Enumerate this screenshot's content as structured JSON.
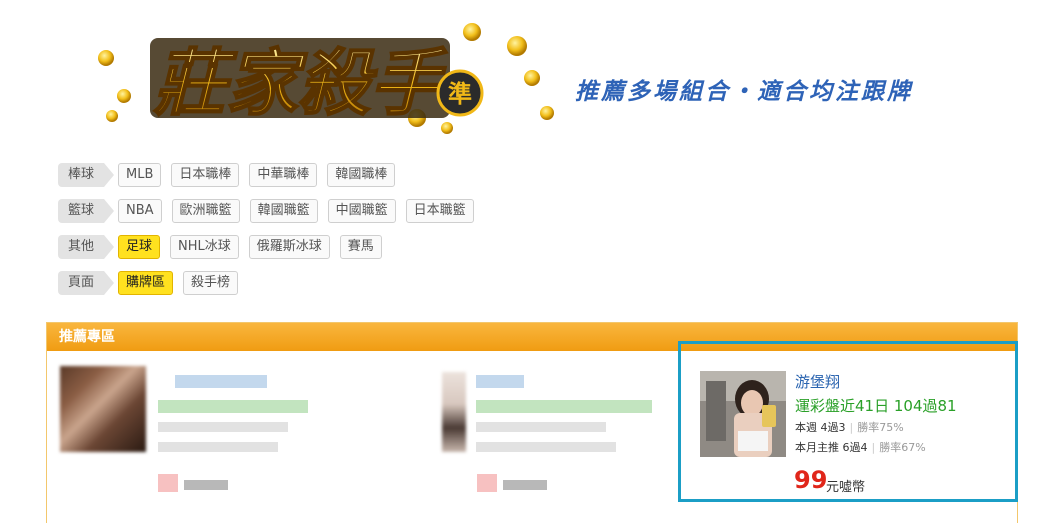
{
  "header": {
    "logo_text": "莊家殺手",
    "logo_badge": "準",
    "slogan": "推薦多場組合・適合均注跟牌"
  },
  "filters": [
    {
      "category": "棒球",
      "items": [
        {
          "label": "MLB",
          "active": false
        },
        {
          "label": "日本職棒",
          "active": false
        },
        {
          "label": "中華職棒",
          "active": false
        },
        {
          "label": "韓國職棒",
          "active": false
        }
      ]
    },
    {
      "category": "籃球",
      "items": [
        {
          "label": "NBA",
          "active": false
        },
        {
          "label": "歐洲職籃",
          "active": false
        },
        {
          "label": "韓國職籃",
          "active": false
        },
        {
          "label": "中國職籃",
          "active": false
        },
        {
          "label": "日本職籃",
          "active": false
        }
      ]
    },
    {
      "category": "其他",
      "items": [
        {
          "label": "足球",
          "active": true
        },
        {
          "label": "NHL冰球",
          "active": false
        },
        {
          "label": "俄羅斯冰球",
          "active": false
        },
        {
          "label": "賽馬",
          "active": false
        }
      ]
    },
    {
      "category": "頁面",
      "items": [
        {
          "label": "購牌區",
          "active": true
        },
        {
          "label": "殺手榜",
          "active": false
        }
      ]
    }
  ],
  "panel": {
    "title": "推薦專區",
    "featured": {
      "name": "游堡翔",
      "record": "運彩盤近41日 104過81",
      "week_record": "本週 4過3",
      "week_rate": "勝率75%",
      "month_record": "本月主推 6過4",
      "month_rate": "勝率67%",
      "price": "99",
      "price_unit": "元噓幣"
    }
  },
  "colors": {
    "accent_blue": "#2a64b0",
    "record_green": "#2aa028",
    "price_red": "#e0261a",
    "active_chip": "#ffe11f",
    "panel_orange": "#f09c12",
    "highlight_border": "#1b9ec6"
  }
}
